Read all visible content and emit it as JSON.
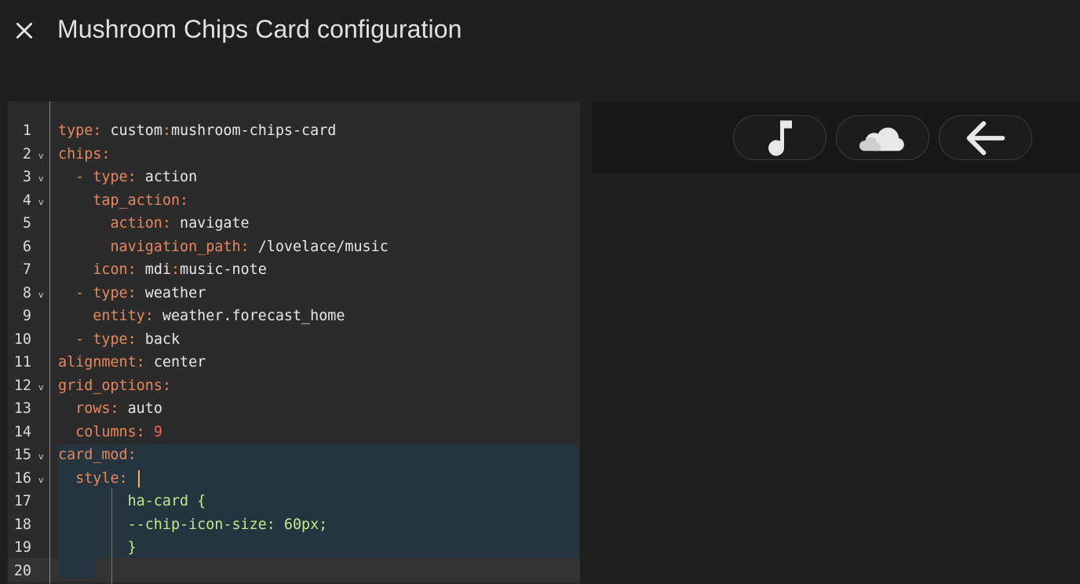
{
  "dialog": {
    "title": "Mushroom Chips Card configuration",
    "close_icon": "close-icon"
  },
  "editor": {
    "lines": [
      {
        "num": "1",
        "fold": false,
        "indent": "",
        "tokens": [
          {
            "t": "type",
            "c": "k"
          },
          {
            "t": ": ",
            "c": "k"
          },
          {
            "t": "custom",
            "c": "v"
          },
          {
            "t": ":",
            "c": "k"
          },
          {
            "t": "mushroom-chips-card",
            "c": "v"
          }
        ]
      },
      {
        "num": "2",
        "fold": true,
        "indent": "",
        "tokens": [
          {
            "t": "chips",
            "c": "k"
          },
          {
            "t": ":",
            "c": "k"
          }
        ]
      },
      {
        "num": "3",
        "fold": true,
        "indent": "  ",
        "tokens": [
          {
            "t": "- ",
            "c": "d"
          },
          {
            "t": "type",
            "c": "k"
          },
          {
            "t": ": ",
            "c": "k"
          },
          {
            "t": "action",
            "c": "v"
          }
        ]
      },
      {
        "num": "4",
        "fold": true,
        "indent": "    ",
        "tokens": [
          {
            "t": "tap_action",
            "c": "k"
          },
          {
            "t": ":",
            "c": "k"
          }
        ]
      },
      {
        "num": "5",
        "fold": false,
        "indent": "      ",
        "tokens": [
          {
            "t": "action",
            "c": "k"
          },
          {
            "t": ": ",
            "c": "k"
          },
          {
            "t": "navigate",
            "c": "v"
          }
        ]
      },
      {
        "num": "6",
        "fold": false,
        "indent": "      ",
        "tokens": [
          {
            "t": "navigation_path",
            "c": "k"
          },
          {
            "t": ": ",
            "c": "k"
          },
          {
            "t": "/lovelace/music",
            "c": "v"
          }
        ]
      },
      {
        "num": "7",
        "fold": false,
        "indent": "    ",
        "tokens": [
          {
            "t": "icon",
            "c": "k"
          },
          {
            "t": ": ",
            "c": "k"
          },
          {
            "t": "mdi",
            "c": "v"
          },
          {
            "t": ":",
            "c": "k"
          },
          {
            "t": "music-note",
            "c": "v"
          }
        ]
      },
      {
        "num": "8",
        "fold": true,
        "indent": "  ",
        "tokens": [
          {
            "t": "- ",
            "c": "d"
          },
          {
            "t": "type",
            "c": "k"
          },
          {
            "t": ": ",
            "c": "k"
          },
          {
            "t": "weather",
            "c": "v"
          }
        ]
      },
      {
        "num": "9",
        "fold": false,
        "indent": "    ",
        "tokens": [
          {
            "t": "entity",
            "c": "k"
          },
          {
            "t": ": ",
            "c": "k"
          },
          {
            "t": "weather.forecast_home",
            "c": "v"
          }
        ]
      },
      {
        "num": "10",
        "fold": false,
        "indent": "  ",
        "tokens": [
          {
            "t": "- ",
            "c": "d"
          },
          {
            "t": "type",
            "c": "k"
          },
          {
            "t": ": ",
            "c": "k"
          },
          {
            "t": "back",
            "c": "v"
          }
        ]
      },
      {
        "num": "11",
        "fold": false,
        "indent": "",
        "tokens": [
          {
            "t": "alignment",
            "c": "k"
          },
          {
            "t": ": ",
            "c": "k"
          },
          {
            "t": "center",
            "c": "v"
          }
        ]
      },
      {
        "num": "12",
        "fold": true,
        "indent": "",
        "tokens": [
          {
            "t": "grid_options",
            "c": "k"
          },
          {
            "t": ":",
            "c": "k"
          }
        ]
      },
      {
        "num": "13",
        "fold": false,
        "indent": "  ",
        "tokens": [
          {
            "t": "rows",
            "c": "k"
          },
          {
            "t": ": ",
            "c": "k"
          },
          {
            "t": "auto",
            "c": "v"
          }
        ]
      },
      {
        "num": "14",
        "fold": false,
        "indent": "  ",
        "tokens": [
          {
            "t": "columns",
            "c": "k"
          },
          {
            "t": ": ",
            "c": "k"
          },
          {
            "t": "9",
            "c": "n"
          }
        ]
      },
      {
        "num": "15",
        "fold": true,
        "indent": "",
        "tokens": [
          {
            "t": "card_mod",
            "c": "k"
          },
          {
            "t": ":",
            "c": "k"
          }
        ]
      },
      {
        "num": "16",
        "fold": true,
        "indent": "  ",
        "tokens": [
          {
            "t": "style",
            "c": "k"
          },
          {
            "t": ": ",
            "c": "k"
          },
          {
            "t": "|",
            "c": "cursor"
          }
        ]
      },
      {
        "num": "17",
        "fold": false,
        "indent": "        ",
        "tokens": [
          {
            "t": "ha-card {",
            "c": "s"
          }
        ]
      },
      {
        "num": "18",
        "fold": false,
        "indent": "        ",
        "tokens": [
          {
            "t": "--chip-icon-size: 60px;",
            "c": "s"
          }
        ]
      },
      {
        "num": "19",
        "fold": false,
        "indent": "        ",
        "tokens": [
          {
            "t": "}",
            "c": "s"
          }
        ]
      },
      {
        "num": "20",
        "fold": false,
        "indent": "",
        "tokens": []
      }
    ],
    "fold_glyph": "v"
  },
  "preview": {
    "chips": [
      {
        "name": "music-note-chip",
        "icon": "music-note-icon"
      },
      {
        "name": "weather-chip",
        "icon": "cloud-icon"
      },
      {
        "name": "back-chip",
        "icon": "arrow-left-icon"
      }
    ]
  }
}
